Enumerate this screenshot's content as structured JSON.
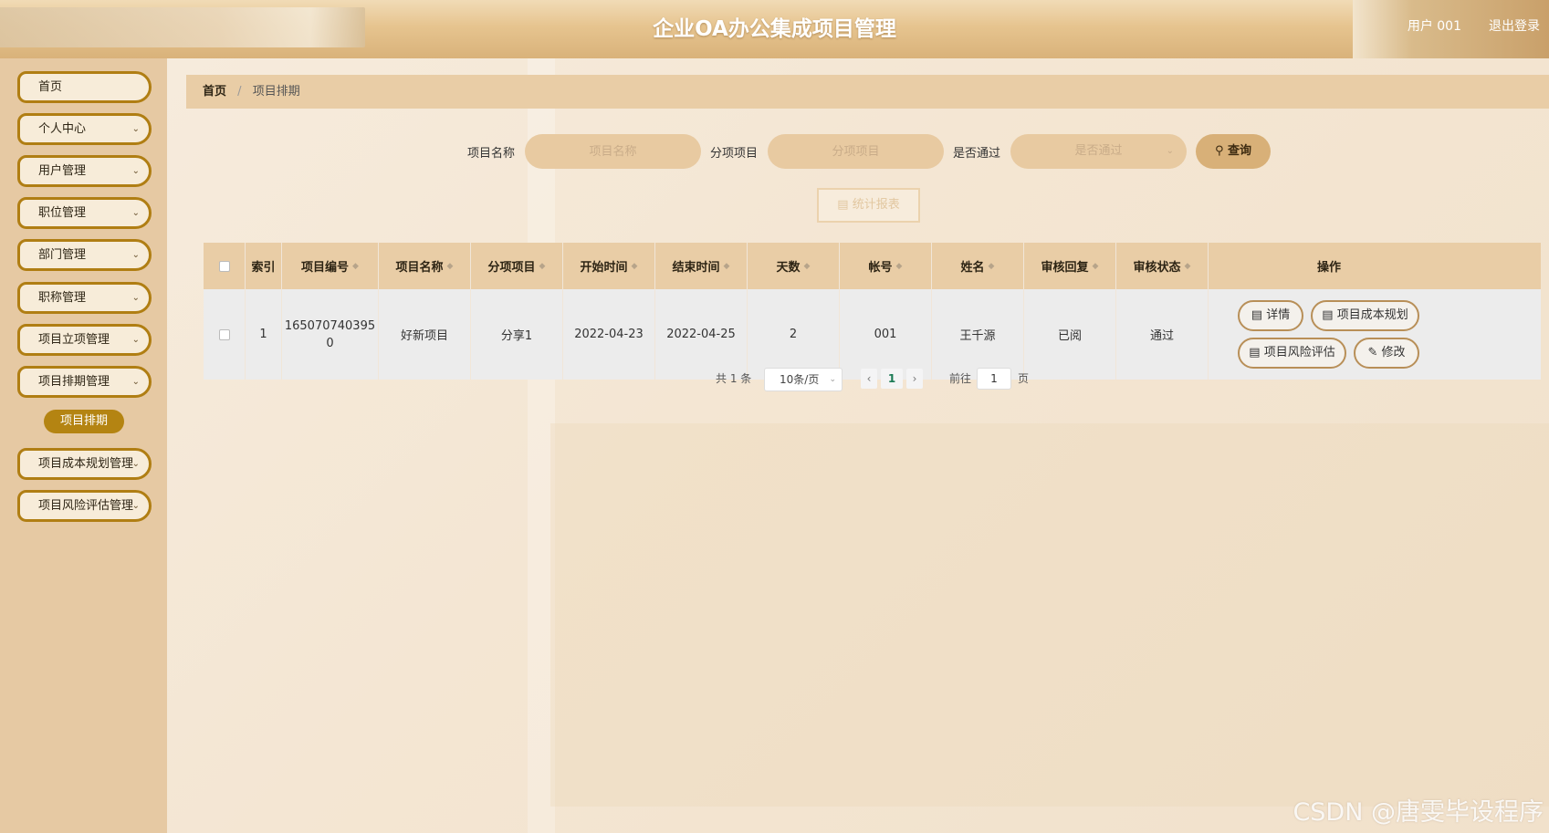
{
  "header": {
    "title": "企业OA办公集成项目管理",
    "user": "用户 001",
    "logout": "退出登录"
  },
  "sidebar": {
    "items": [
      {
        "label": "首页",
        "has_children": false
      },
      {
        "label": "个人中心",
        "has_children": true
      },
      {
        "label": "用户管理",
        "has_children": true
      },
      {
        "label": "职位管理",
        "has_children": true
      },
      {
        "label": "部门管理",
        "has_children": true
      },
      {
        "label": "职称管理",
        "has_children": true
      },
      {
        "label": "项目立项管理",
        "has_children": true
      },
      {
        "label": "项目排期管理",
        "has_children": true
      },
      {
        "label": "项目成本规划管理",
        "has_children": true
      },
      {
        "label": "项目风险评估管理",
        "has_children": true
      }
    ],
    "active_sub": "项目排期"
  },
  "breadcrumb": {
    "home": "首页",
    "sep": "/",
    "current": "项目排期"
  },
  "search": {
    "name_label": "项目名称",
    "name_placeholder": "项目名称",
    "sub_label": "分项项目",
    "sub_placeholder": "分项项目",
    "pass_label": "是否通过",
    "pass_placeholder": "是否通过",
    "query_button": "查询",
    "report_button": "统计报表"
  },
  "table": {
    "headers": [
      "索引",
      "项目编号",
      "项目名称",
      "分项项目",
      "开始时间",
      "结束时间",
      "天数",
      "帐号",
      "姓名",
      "审核回复",
      "审核状态",
      "操作"
    ],
    "rows": [
      {
        "index": "1",
        "code": "165070740395\n0",
        "name": "好新项目",
        "sub": "分享1",
        "start": "2022-04-23",
        "end": "2022-04-25",
        "days": "2",
        "account": "001",
        "person": "王千源",
        "reply": "已阅",
        "status": "通过"
      }
    ],
    "actions": {
      "detail": "详情",
      "cost": "项目成本规划",
      "risk": "项目风险评估",
      "edit": "修改"
    }
  },
  "pagination": {
    "total": "共 1 条",
    "page_size": "10条/页",
    "current_page": "1",
    "goto_label": "前往",
    "goto_value": "1",
    "page_suffix": "页"
  },
  "watermark": "CSDN @唐雯毕设程序",
  "colors": {
    "accent": "#b07e13",
    "sidebar_bg": "#e6c9a3",
    "header_bg": "#e6c48f"
  }
}
